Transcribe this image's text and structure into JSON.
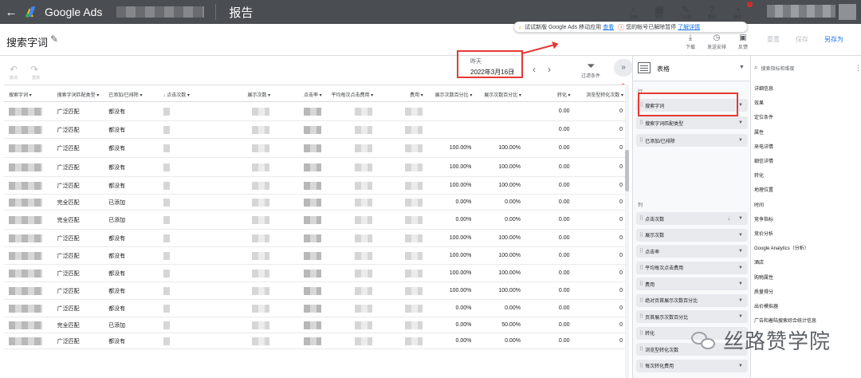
{
  "app": {
    "brand": "Google Ads",
    "report_title": "报告"
  },
  "top_icons": [
    {
      "icon": "search-icon",
      "glyph": "⌕",
      "label": "搜索"
    },
    {
      "icon": "reports-icon",
      "glyph": "▦",
      "label": "报告"
    },
    {
      "icon": "tools-icon",
      "glyph": "✎",
      "label": "工具和"
    },
    {
      "icon": "help-icon",
      "glyph": "?",
      "label": "帮助"
    },
    {
      "icon": "bell-icon",
      "glyph": "🔔",
      "label": "通知"
    }
  ],
  "notification_count": "1",
  "page": {
    "title": "搜索字词"
  },
  "banner": {
    "promo_text": "试试新版 Google Ads 移动应用",
    "promo_link": "查看",
    "warning_text": "您的帐号已解除暂停",
    "warning_link": "了解详情"
  },
  "actions": [
    {
      "icon": "download-icon",
      "glyph": "⤓",
      "label": "下载"
    },
    {
      "icon": "schedule-icon",
      "glyph": "◷",
      "label": "发送安排"
    },
    {
      "icon": "feedback-icon",
      "glyph": "▣",
      "label": "反馈"
    }
  ],
  "right_buttons": {
    "reset": "重置",
    "save": "保存",
    "save_as": "另存为"
  },
  "toolbar": {
    "undo": "撤消",
    "redo": "重做",
    "filter_label": "过滤条件"
  },
  "date": {
    "relative": "昨天",
    "value": "2022年3月16日"
  },
  "table": {
    "headers": [
      "搜索字词",
      "搜索字词匹配类型",
      "已添加/已排除",
      "↓ 点击次数",
      "展示次数",
      "点击率",
      "平均每次点击费用",
      "费用",
      "展示次数百分比",
      "展示次数百分比",
      "转化",
      "浏览型转化次数"
    ],
    "rows": [
      [
        "",
        "广泛匹配",
        "都没有",
        "",
        "",
        "",
        "",
        "",
        "",
        "",
        "0.00",
        "0"
      ],
      [
        "",
        "广泛匹配",
        "都没有",
        "",
        "",
        "",
        "",
        "",
        "",
        "",
        "0.00",
        "0"
      ],
      [
        "",
        "广泛匹配",
        "都没有",
        "",
        "",
        "",
        "",
        "",
        "100.00%",
        "100.00%",
        "0.00",
        "0"
      ],
      [
        "",
        "广泛匹配",
        "都没有",
        "",
        "",
        "",
        "",
        "",
        "100.00%",
        "100.00%",
        "0.00",
        "0"
      ],
      [
        "",
        "广泛匹配",
        "都没有",
        "",
        "",
        "",
        "",
        "",
        "100.00%",
        "100.00%",
        "0.00",
        "0"
      ],
      [
        "",
        "完全匹配",
        "已添加",
        "",
        "",
        "",
        "",
        "",
        "0.00%",
        "0.00%",
        "0.00",
        "0"
      ],
      [
        "",
        "完全匹配",
        "已添加",
        "",
        "",
        "",
        "",
        "",
        "0.00%",
        "0.00%",
        "0.00",
        "0"
      ],
      [
        "",
        "广泛匹配",
        "都没有",
        "",
        "",
        "",
        "",
        "",
        "100.00%",
        "100.00%",
        "0.00",
        "0"
      ],
      [
        "",
        "广泛匹配",
        "都没有",
        "",
        "",
        "",
        "",
        "",
        "100.00%",
        "100.00%",
        "0.00",
        "0"
      ],
      [
        "",
        "广泛匹配",
        "都没有",
        "",
        "",
        "",
        "",
        "",
        "100.00%",
        "100.00%",
        "0.00",
        "0"
      ],
      [
        "",
        "广泛匹配",
        "都没有",
        "",
        "",
        "",
        "",
        "",
        "100.00%",
        "100.00%",
        "0.00",
        "0"
      ],
      [
        "",
        "广泛匹配",
        "都没有",
        "",
        "",
        "",
        "",
        "",
        "0.00%",
        "0.00%",
        "0.00",
        "0"
      ],
      [
        "",
        "完全匹配",
        "已添加",
        "",
        "",
        "",
        "",
        "",
        "0.00%",
        "50.00%",
        "0.00",
        "0"
      ],
      [
        "",
        "广泛匹配",
        "都没有",
        "",
        "",
        "",
        "",
        "",
        "0.00%",
        "0.00%",
        "0.00",
        "0"
      ]
    ]
  },
  "panel": {
    "viz": "表格",
    "rows_label": "行",
    "rows": [
      "搜索字词",
      "搜索字词匹配类型",
      "已添加/已排除"
    ],
    "cols_label": "列",
    "cols": [
      "点击次数",
      "展示次数",
      "点击率",
      "平均每次点击费用",
      "费用",
      "绝对页首展示次数百分比",
      "页首展示次数百分比",
      "转化",
      "浏览型转化次数",
      "每次转化费用"
    ]
  },
  "dimensions": {
    "search_placeholder": "搜索指标和维度",
    "items": [
      "详细信息",
      "效果",
      "定位条件",
      "属性",
      "来电详情",
      "细信详情",
      "转化",
      "地理位置",
      "时间",
      "竞争指标",
      "竞价分析",
      "Google Analytics（分析）",
      "酒店",
      "购物属性",
      "质量得分",
      "出价模拟器",
      "广告和着陆搜索综合统计信息"
    ]
  },
  "watermark": "丝路赞学院"
}
